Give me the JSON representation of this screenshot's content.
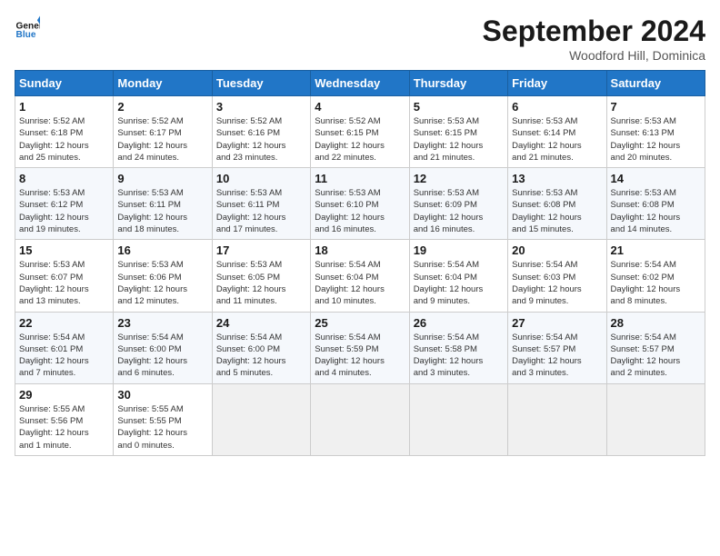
{
  "header": {
    "logo_line1": "General",
    "logo_line2": "Blue",
    "month_year": "September 2024",
    "location": "Woodford Hill, Dominica"
  },
  "weekdays": [
    "Sunday",
    "Monday",
    "Tuesday",
    "Wednesday",
    "Thursday",
    "Friday",
    "Saturday"
  ],
  "weeks": [
    [
      {
        "day": "1",
        "info": "Sunrise: 5:52 AM\nSunset: 6:18 PM\nDaylight: 12 hours\nand 25 minutes."
      },
      {
        "day": "2",
        "info": "Sunrise: 5:52 AM\nSunset: 6:17 PM\nDaylight: 12 hours\nand 24 minutes."
      },
      {
        "day": "3",
        "info": "Sunrise: 5:52 AM\nSunset: 6:16 PM\nDaylight: 12 hours\nand 23 minutes."
      },
      {
        "day": "4",
        "info": "Sunrise: 5:52 AM\nSunset: 6:15 PM\nDaylight: 12 hours\nand 22 minutes."
      },
      {
        "day": "5",
        "info": "Sunrise: 5:53 AM\nSunset: 6:15 PM\nDaylight: 12 hours\nand 21 minutes."
      },
      {
        "day": "6",
        "info": "Sunrise: 5:53 AM\nSunset: 6:14 PM\nDaylight: 12 hours\nand 21 minutes."
      },
      {
        "day": "7",
        "info": "Sunrise: 5:53 AM\nSunset: 6:13 PM\nDaylight: 12 hours\nand 20 minutes."
      }
    ],
    [
      {
        "day": "8",
        "info": "Sunrise: 5:53 AM\nSunset: 6:12 PM\nDaylight: 12 hours\nand 19 minutes."
      },
      {
        "day": "9",
        "info": "Sunrise: 5:53 AM\nSunset: 6:11 PM\nDaylight: 12 hours\nand 18 minutes."
      },
      {
        "day": "10",
        "info": "Sunrise: 5:53 AM\nSunset: 6:11 PM\nDaylight: 12 hours\nand 17 minutes."
      },
      {
        "day": "11",
        "info": "Sunrise: 5:53 AM\nSunset: 6:10 PM\nDaylight: 12 hours\nand 16 minutes."
      },
      {
        "day": "12",
        "info": "Sunrise: 5:53 AM\nSunset: 6:09 PM\nDaylight: 12 hours\nand 16 minutes."
      },
      {
        "day": "13",
        "info": "Sunrise: 5:53 AM\nSunset: 6:08 PM\nDaylight: 12 hours\nand 15 minutes."
      },
      {
        "day": "14",
        "info": "Sunrise: 5:53 AM\nSunset: 6:08 PM\nDaylight: 12 hours\nand 14 minutes."
      }
    ],
    [
      {
        "day": "15",
        "info": "Sunrise: 5:53 AM\nSunset: 6:07 PM\nDaylight: 12 hours\nand 13 minutes."
      },
      {
        "day": "16",
        "info": "Sunrise: 5:53 AM\nSunset: 6:06 PM\nDaylight: 12 hours\nand 12 minutes."
      },
      {
        "day": "17",
        "info": "Sunrise: 5:53 AM\nSunset: 6:05 PM\nDaylight: 12 hours\nand 11 minutes."
      },
      {
        "day": "18",
        "info": "Sunrise: 5:54 AM\nSunset: 6:04 PM\nDaylight: 12 hours\nand 10 minutes."
      },
      {
        "day": "19",
        "info": "Sunrise: 5:54 AM\nSunset: 6:04 PM\nDaylight: 12 hours\nand 9 minutes."
      },
      {
        "day": "20",
        "info": "Sunrise: 5:54 AM\nSunset: 6:03 PM\nDaylight: 12 hours\nand 9 minutes."
      },
      {
        "day": "21",
        "info": "Sunrise: 5:54 AM\nSunset: 6:02 PM\nDaylight: 12 hours\nand 8 minutes."
      }
    ],
    [
      {
        "day": "22",
        "info": "Sunrise: 5:54 AM\nSunset: 6:01 PM\nDaylight: 12 hours\nand 7 minutes."
      },
      {
        "day": "23",
        "info": "Sunrise: 5:54 AM\nSunset: 6:00 PM\nDaylight: 12 hours\nand 6 minutes."
      },
      {
        "day": "24",
        "info": "Sunrise: 5:54 AM\nSunset: 6:00 PM\nDaylight: 12 hours\nand 5 minutes."
      },
      {
        "day": "25",
        "info": "Sunrise: 5:54 AM\nSunset: 5:59 PM\nDaylight: 12 hours\nand 4 minutes."
      },
      {
        "day": "26",
        "info": "Sunrise: 5:54 AM\nSunset: 5:58 PM\nDaylight: 12 hours\nand 3 minutes."
      },
      {
        "day": "27",
        "info": "Sunrise: 5:54 AM\nSunset: 5:57 PM\nDaylight: 12 hours\nand 3 minutes."
      },
      {
        "day": "28",
        "info": "Sunrise: 5:54 AM\nSunset: 5:57 PM\nDaylight: 12 hours\nand 2 minutes."
      }
    ],
    [
      {
        "day": "29",
        "info": "Sunrise: 5:55 AM\nSunset: 5:56 PM\nDaylight: 12 hours\nand 1 minute."
      },
      {
        "day": "30",
        "info": "Sunrise: 5:55 AM\nSunset: 5:55 PM\nDaylight: 12 hours\nand 0 minutes."
      },
      {
        "day": "",
        "info": ""
      },
      {
        "day": "",
        "info": ""
      },
      {
        "day": "",
        "info": ""
      },
      {
        "day": "",
        "info": ""
      },
      {
        "day": "",
        "info": ""
      }
    ]
  ]
}
